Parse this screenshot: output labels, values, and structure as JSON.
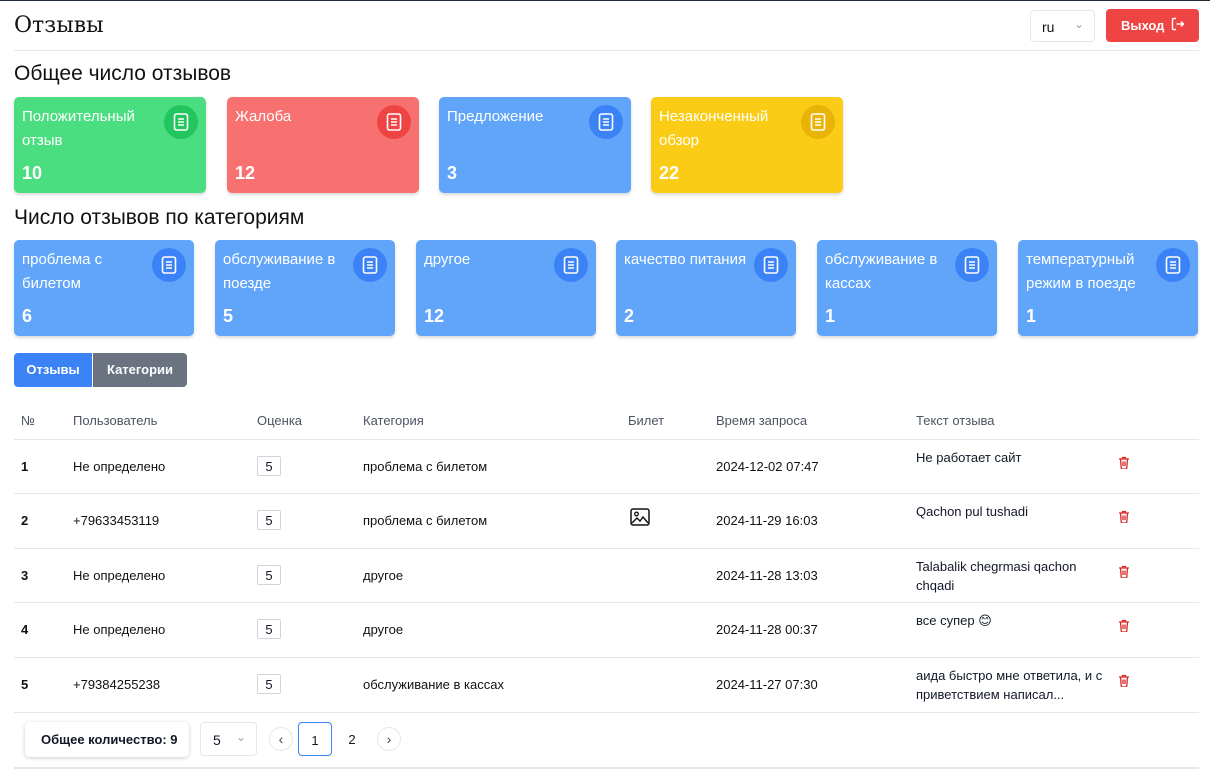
{
  "header": {
    "title": "Отзывы",
    "lang": "ru",
    "logout_label": "Выход"
  },
  "summary": {
    "title": "Общее число отзывов",
    "cards": [
      {
        "label": "Положительный отзыв",
        "value": "10",
        "color": "#4ade80",
        "icon_color": "#22c55e"
      },
      {
        "label": "Жалоба",
        "value": "12",
        "color": "#f87171",
        "icon_color": "#ef4444"
      },
      {
        "label": "Предложение",
        "value": "3",
        "color": "#60a5fa",
        "icon_color": "#3b82f6"
      },
      {
        "label": "Незаконченный обзор",
        "value": "22",
        "color": "#facc15",
        "icon_color": "#eab308"
      }
    ]
  },
  "categories": {
    "title": "Число отзывов по категориям",
    "cards": [
      {
        "label": "проблема с билетом",
        "value": "6"
      },
      {
        "label": "обслуживание в поезде",
        "value": "5"
      },
      {
        "label": "другое",
        "value": "12"
      },
      {
        "label": "качество питания",
        "value": "2"
      },
      {
        "label": "обслуживание в кассах",
        "value": "1"
      },
      {
        "label": "температурный режим в поезде",
        "value": "1"
      }
    ]
  },
  "tabs": [
    "Отзывы",
    "Категории"
  ],
  "table": {
    "columns": [
      "№",
      "Пользователь",
      "Оценка",
      "Категория",
      "Билет",
      "Время запроса",
      "Текст отзыва"
    ],
    "rows": [
      {
        "num": "1",
        "user": "Не определено",
        "score": "5",
        "category": "проблема с билетом",
        "ticket": "",
        "time": "2024-12-02 07:47",
        "text": "Не работает сайт"
      },
      {
        "num": "2",
        "user": "+79633453119",
        "score": "5",
        "category": "проблема с билетом",
        "ticket": "image-icon",
        "time": "2024-11-29 16:03",
        "text": "Qachon pul tushadi"
      },
      {
        "num": "3",
        "user": "Не определено",
        "score": "5",
        "category": "другое",
        "ticket": "",
        "time": "2024-11-28 13:03",
        "text": "Talabalik chegrmasi qachon chqadi"
      },
      {
        "num": "4",
        "user": "Не определено",
        "score": "5",
        "category": "другое",
        "ticket": "",
        "time": "2024-11-28 00:37",
        "text": "все супер 😊"
      },
      {
        "num": "5",
        "user": "+79384255238",
        "score": "5",
        "category": "обслуживание в кассах",
        "ticket": "",
        "time": "2024-11-27 07:30",
        "text": "аида быстро мне ответила, и с приветствием написал..."
      }
    ]
  },
  "pagination": {
    "total_label": "Общее количество: 9",
    "page_size": "5",
    "pages": [
      "1",
      "2"
    ],
    "current_page": "1"
  },
  "colors": {
    "category_card": "#60a5fa",
    "category_icon": "#3b82f6",
    "delete": "#dc2626",
    "primary": "#3b82f6"
  }
}
